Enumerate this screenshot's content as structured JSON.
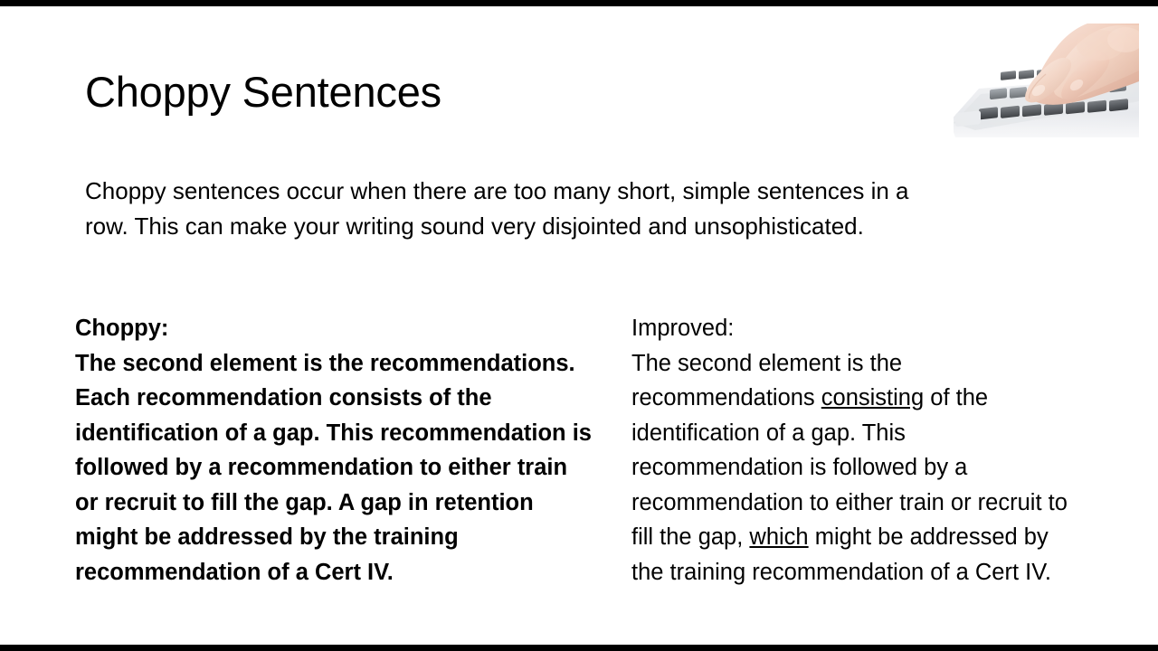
{
  "slide": {
    "title": "Choppy Sentences",
    "intro": "Choppy sentences occur when there are too many short, simple sentences in a row. This can make your writing sound very disjointed and unsophisticated.",
    "columns": {
      "left": {
        "heading": "Choppy:",
        "body": "The second element is the recommendations. Each recommendation consists of the identification of a gap. This recommendation is followed by a recommendation to either train or recruit to fill the gap. A gap in retention might be addressed by the training recommendation of a Cert IV."
      },
      "right": {
        "heading": "Improved:",
        "body_part_1": "The second element is the recommendations ",
        "body_underline_1": "consisting",
        "body_part_2": " of the identification of a gap. This recommendation is followed by a recommendation to either train or recruit to fill the gap, ",
        "body_underline_2": "which",
        "body_part_3": " might be addressed by the training recommendation of a Cert IV."
      }
    },
    "image": {
      "alt": "hands-typing-on-keyboard-photo"
    },
    "colors": {
      "background": "#ffffff",
      "text": "#000000",
      "letterbox_bar": "#000000"
    }
  }
}
